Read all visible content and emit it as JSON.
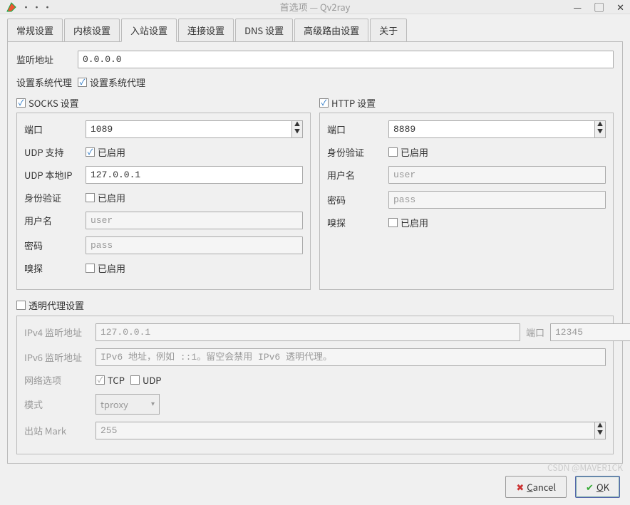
{
  "window": {
    "title": "首选项 — Qv2ray"
  },
  "tabs": [
    "常规设置",
    "内核设置",
    "入站设置",
    "连接设置",
    "DNS 设置",
    "高级路由设置",
    "关于"
  ],
  "active_tab": 2,
  "listen": {
    "label": "监听地址",
    "value": "0.0.0.0"
  },
  "sysproxy": {
    "label": "设置系统代理",
    "chk_label": "设置系统代理"
  },
  "socks": {
    "header": "SOCKS 设置",
    "port": {
      "label": "端口",
      "value": "1089"
    },
    "udp": {
      "label": "UDP 支持",
      "chk": "已启用"
    },
    "localip": {
      "label": "UDP 本地IP",
      "value": "127.0.0.1"
    },
    "auth": {
      "label": "身份验证",
      "chk": "已启用"
    },
    "user": {
      "label": "用户名",
      "ph": "user"
    },
    "pass": {
      "label": "密码",
      "ph": "pass"
    },
    "sniff": {
      "label": "嗅探",
      "chk": "已启用"
    }
  },
  "http": {
    "header": "HTTP 设置",
    "port": {
      "label": "端口",
      "value": "8889"
    },
    "auth": {
      "label": "身份验证",
      "chk": "已启用"
    },
    "user": {
      "label": "用户名",
      "ph": "user"
    },
    "pass": {
      "label": "密码",
      "ph": "pass"
    },
    "sniff": {
      "label": "嗅探",
      "chk": "已启用"
    }
  },
  "tproxy": {
    "header": "透明代理设置",
    "ipv4": {
      "label": "IPv4 监听地址",
      "value": "127.0.0.1"
    },
    "port": {
      "label": "端口",
      "value": "12345"
    },
    "ipv6": {
      "label": "IPv6 监听地址",
      "ph": "IPv6 地址，例如 ::1。留空会禁用 IPv6 透明代理。"
    },
    "net": {
      "label": "网络选项",
      "tcp": "TCP",
      "udp": "UDP"
    },
    "mode": {
      "label": "模式",
      "value": "tproxy"
    },
    "mark": {
      "label": "出站 Mark",
      "value": "255"
    }
  },
  "buttons": {
    "cancel": "Cancel",
    "ok": "OK"
  },
  "watermark": "CSDN @MAVER1CK"
}
